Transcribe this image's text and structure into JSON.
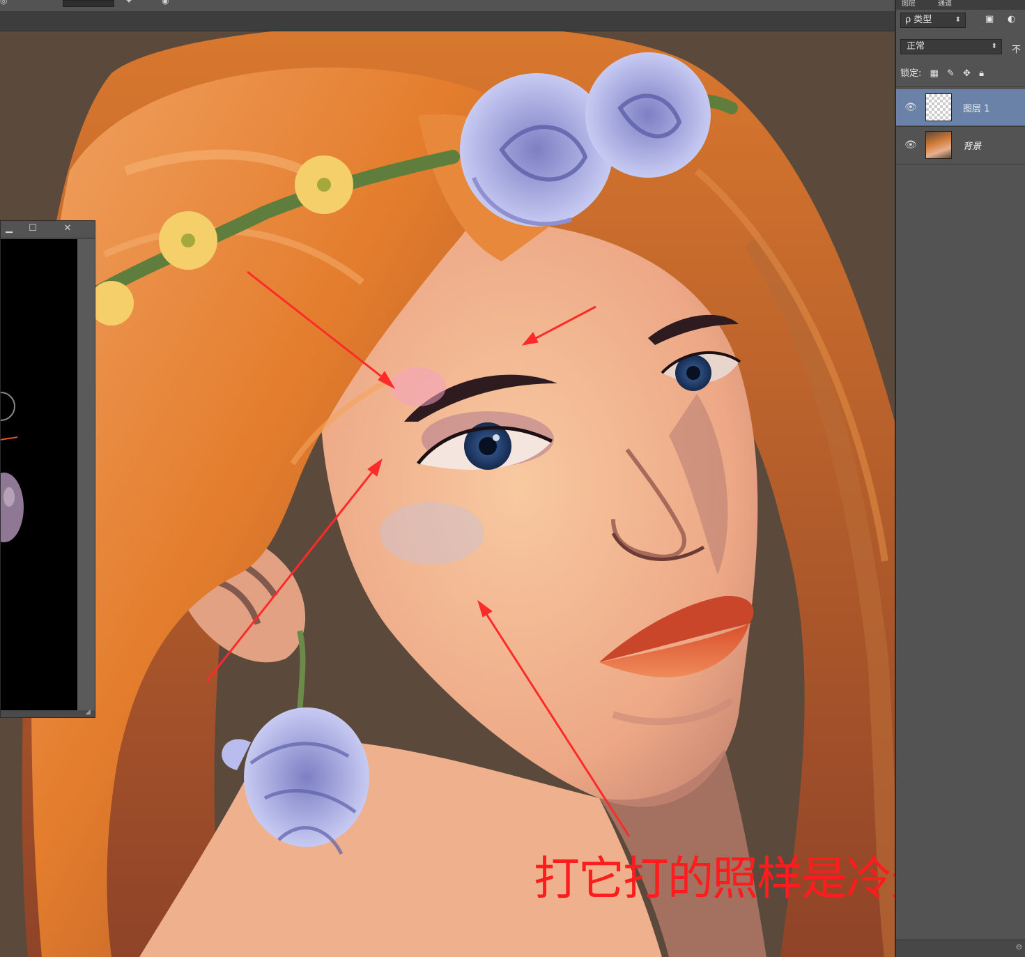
{
  "annotation": {
    "text": "打它打的照样是冷光",
    "color": "#ff1c1c"
  },
  "layers_panel": {
    "tabs": [
      "图层",
      "通道"
    ],
    "filter_label": "ρ 类型",
    "blend_mode": "正常",
    "opacity_label": "不",
    "lock_label": "锁定:",
    "layers": [
      {
        "name": "图层 1",
        "selected": true,
        "visible": true
      },
      {
        "name": "背景",
        "selected": false,
        "visible": true
      }
    ]
  },
  "subwindow": {
    "minimize": "▁",
    "maximize": "☐",
    "close": "✕"
  },
  "icons": [
    "eye-icon",
    "lock-icon",
    "brush-icon",
    "move-icon",
    "checker-icon",
    "image-icon"
  ],
  "colors": {
    "canvas_bg": "#5b4a3b",
    "panel_bg": "#535353",
    "selected_layer": "#6a82a8",
    "annotation": "#ff1c1c"
  }
}
